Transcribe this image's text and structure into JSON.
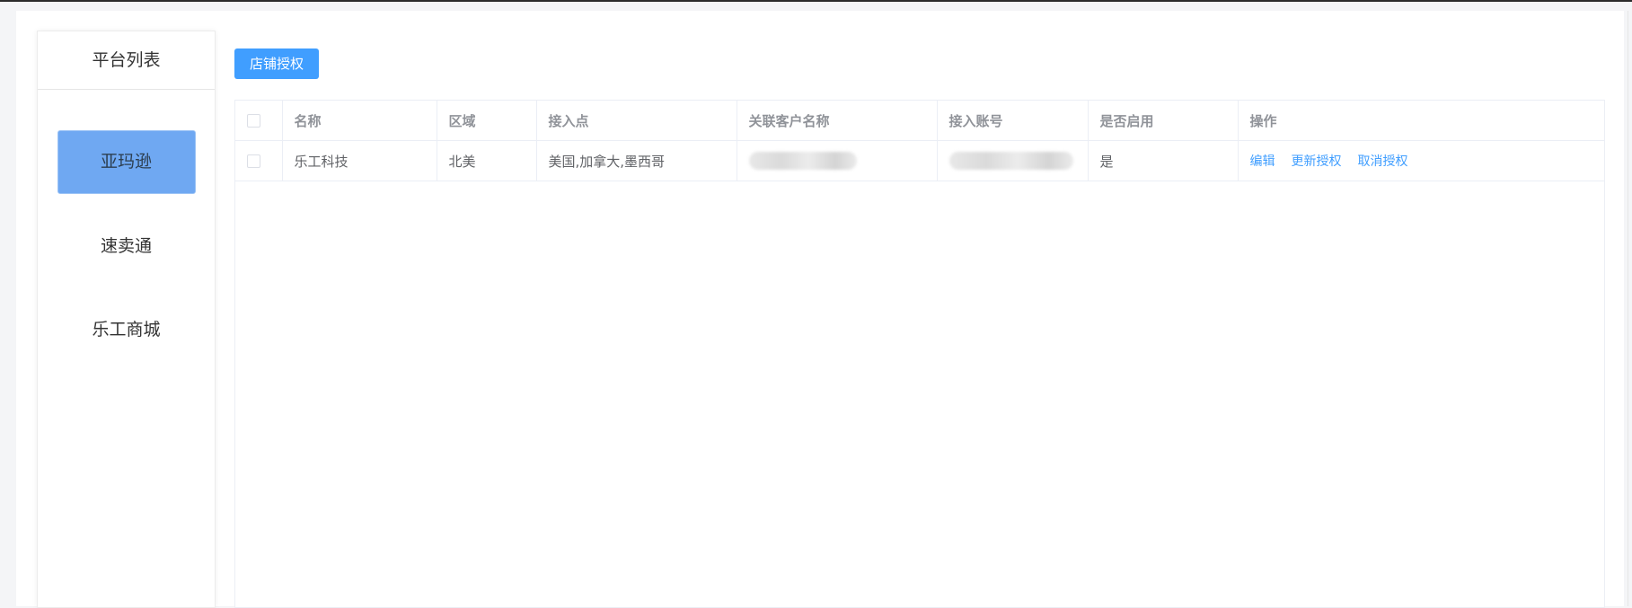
{
  "sidebar": {
    "title": "平台列表",
    "items": [
      {
        "label": "亚玛逊",
        "active": true
      },
      {
        "label": "速卖通",
        "active": false
      },
      {
        "label": "乐工商城",
        "active": false
      }
    ]
  },
  "toolbar": {
    "auth_button_label": "店铺授权"
  },
  "table": {
    "columns": [
      "名称",
      "区域",
      "接入点",
      "关联客户名称",
      "接入账号",
      "是否启用",
      "操作"
    ],
    "rows": [
      {
        "name": "乐工科技",
        "region": "北美",
        "endpoints": "美国,加拿大,墨西哥",
        "customer_name": "",
        "account": "",
        "enabled": "是",
        "actions": [
          "编辑",
          "更新授权",
          "取消授权"
        ]
      }
    ]
  },
  "colors": {
    "primary": "#409eff",
    "active_platform_bg": "#6fa8f2"
  }
}
